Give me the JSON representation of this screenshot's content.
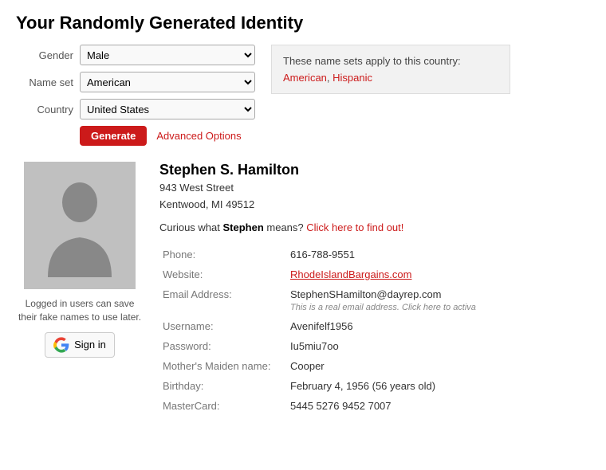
{
  "page": {
    "title": "Your Randomly Generated Identity"
  },
  "form": {
    "gender_label": "Gender",
    "gender_value": "Male",
    "nameset_label": "Name set",
    "nameset_value": "American",
    "country_label": "Country",
    "country_value": "United States",
    "generate_label": "Generate",
    "advanced_label": "Advanced Options"
  },
  "namesets_box": {
    "title": "These name sets apply to this country:",
    "sets": [
      "American",
      "Hispanic"
    ]
  },
  "person": {
    "name": "Stephen S. Hamilton",
    "address_line1": "943 West Street",
    "address_line2": "Kentwood, MI 49512",
    "curious_text": "Curious what ",
    "curious_name": "Stephen",
    "curious_suffix": " means? ",
    "curious_link": "Click here to find out!",
    "phone_label": "Phone:",
    "phone_value": "616-788-9551",
    "website_label": "Website:",
    "website_value": "RhodeIslandBargains.com",
    "email_label": "Email Address:",
    "email_value": "StephenSHamilton@dayrep.com",
    "email_note": "This is a real email address. Click here to activa",
    "username_label": "Username:",
    "username_value": "Avenifelf1956",
    "password_label": "Password:",
    "password_value": "Iu5miu7oo",
    "maiden_label": "Mother's Maiden name:",
    "maiden_value": "Cooper",
    "birthday_label": "Birthday:",
    "birthday_value": "February 4, 1956 (56 years old)",
    "mastercard_label": "MasterCard:",
    "mastercard_value": "5445 5276 9452 7007"
  },
  "signin": {
    "note": "Logged in users can save their fake names to use later.",
    "button_label": "Sign in"
  }
}
